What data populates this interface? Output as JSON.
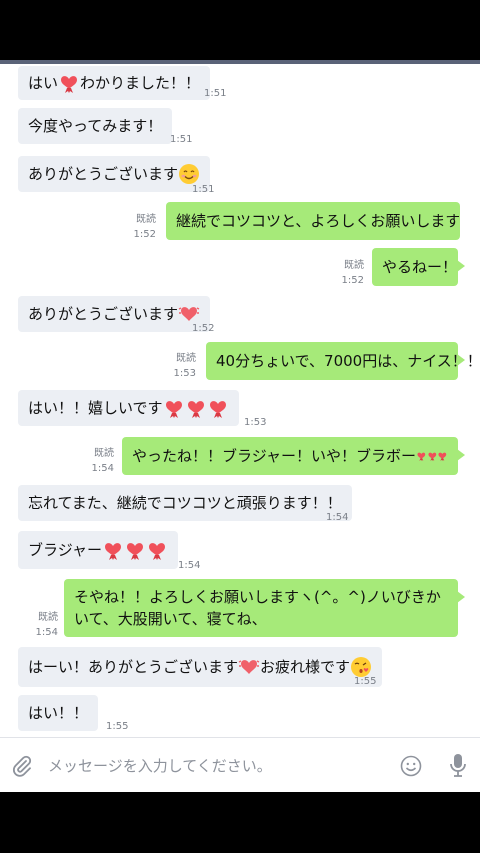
{
  "chat": {
    "messages": [
      {
        "dir": "in",
        "text_a": "はい",
        "hearts": "1",
        "text_b": "わかりました！！",
        "time": "1:51"
      },
      {
        "dir": "in",
        "text": "今度やってみます！",
        "time": "1:51"
      },
      {
        "dir": "in",
        "text": "ありがとうございます",
        "emoji": "smile",
        "time": "1:51"
      },
      {
        "dir": "out",
        "text": "継続でコツコツと、よろしくお願いします(^^ゞ",
        "read": "既読",
        "time": "1:52"
      },
      {
        "dir": "out",
        "text": "やるねー！",
        "read": "既読",
        "time": "1:52"
      },
      {
        "dir": "in",
        "text": "ありがとうございます",
        "emoji": "heart",
        "time": "1:52"
      },
      {
        "dir": "out",
        "text": "40分ちょいで、7000円は、ナイス！！",
        "read": "既読",
        "time": "1:53"
      },
      {
        "dir": "in",
        "text": "はい！！嬉しいです",
        "hearts": "3",
        "time": "1:53"
      },
      {
        "dir": "out",
        "text": "やったね！！ブラジャー！いや！ブラボー",
        "hearts": "3",
        "read": "既読",
        "time": "1:54"
      },
      {
        "dir": "in",
        "text": "忘れてまた、継続でコツコツと頑張ります！！",
        "time": "1:54"
      },
      {
        "dir": "in",
        "text": "ブラジャー",
        "hearts": "3",
        "time": "1:54"
      },
      {
        "dir": "out",
        "text": "そやね！！よろしくお願いしますヽ(^。^)ノいびきかいて、大股開いて、寝てね、",
        "read": "既読",
        "time": "1:54"
      },
      {
        "dir": "in",
        "text_a": "はーい！ありがとうございます",
        "text_b": "お疲れ様です",
        "time": "1:55"
      },
      {
        "dir": "in",
        "text": "はい！！",
        "time": "1:55"
      }
    ]
  },
  "input": {
    "placeholder": "メッセージを入力してください。"
  },
  "colors": {
    "outgoing": "#a6ea79",
    "incoming": "#eceff4",
    "heart": "#f0505a"
  },
  "icons": {
    "attach": "paperclip-icon",
    "emoji": "smiley-icon",
    "mic": "microphone-icon"
  }
}
